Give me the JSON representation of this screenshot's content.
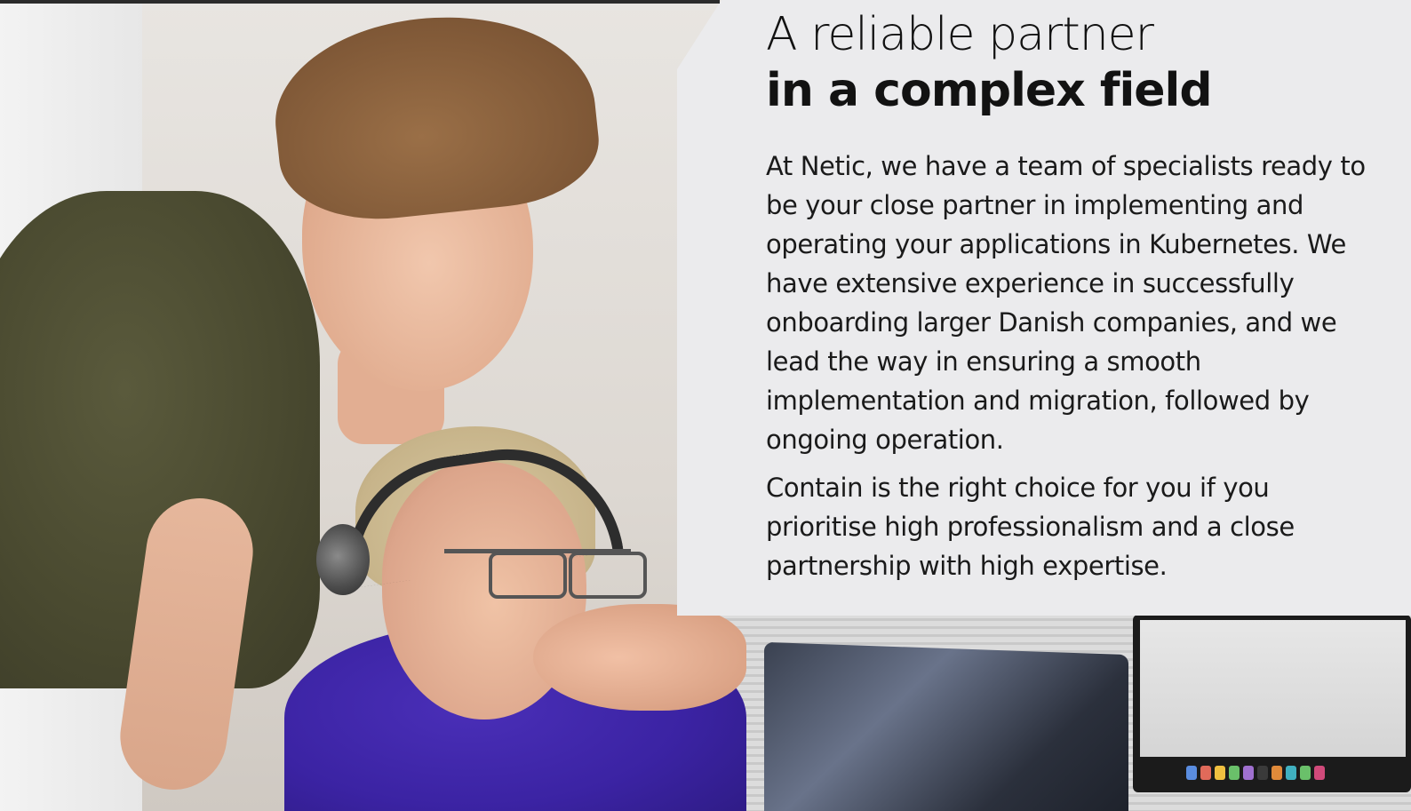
{
  "section": {
    "headline_line1": "A reliable partner",
    "headline_line2": "in a complex field",
    "paragraph1": "At Netic, we have a team of specialists ready to be your close partner in implementing and operating your applications in Kubernetes. We have extensive experience in successfully onboarding larger Danish companies, and we lead the way in ensuring a smooth implementation and migration, followed by ongoing operation.",
    "paragraph2": "Contain is the right choice for you if you prioritise high professionalism and a close partnership with high expertise."
  },
  "colors": {
    "panel_background": "#ebebed",
    "text": "#1a1a1a",
    "top_bar": "#2b2b2b"
  },
  "image": {
    "description_icon": "photo-two-people-at-computer"
  }
}
